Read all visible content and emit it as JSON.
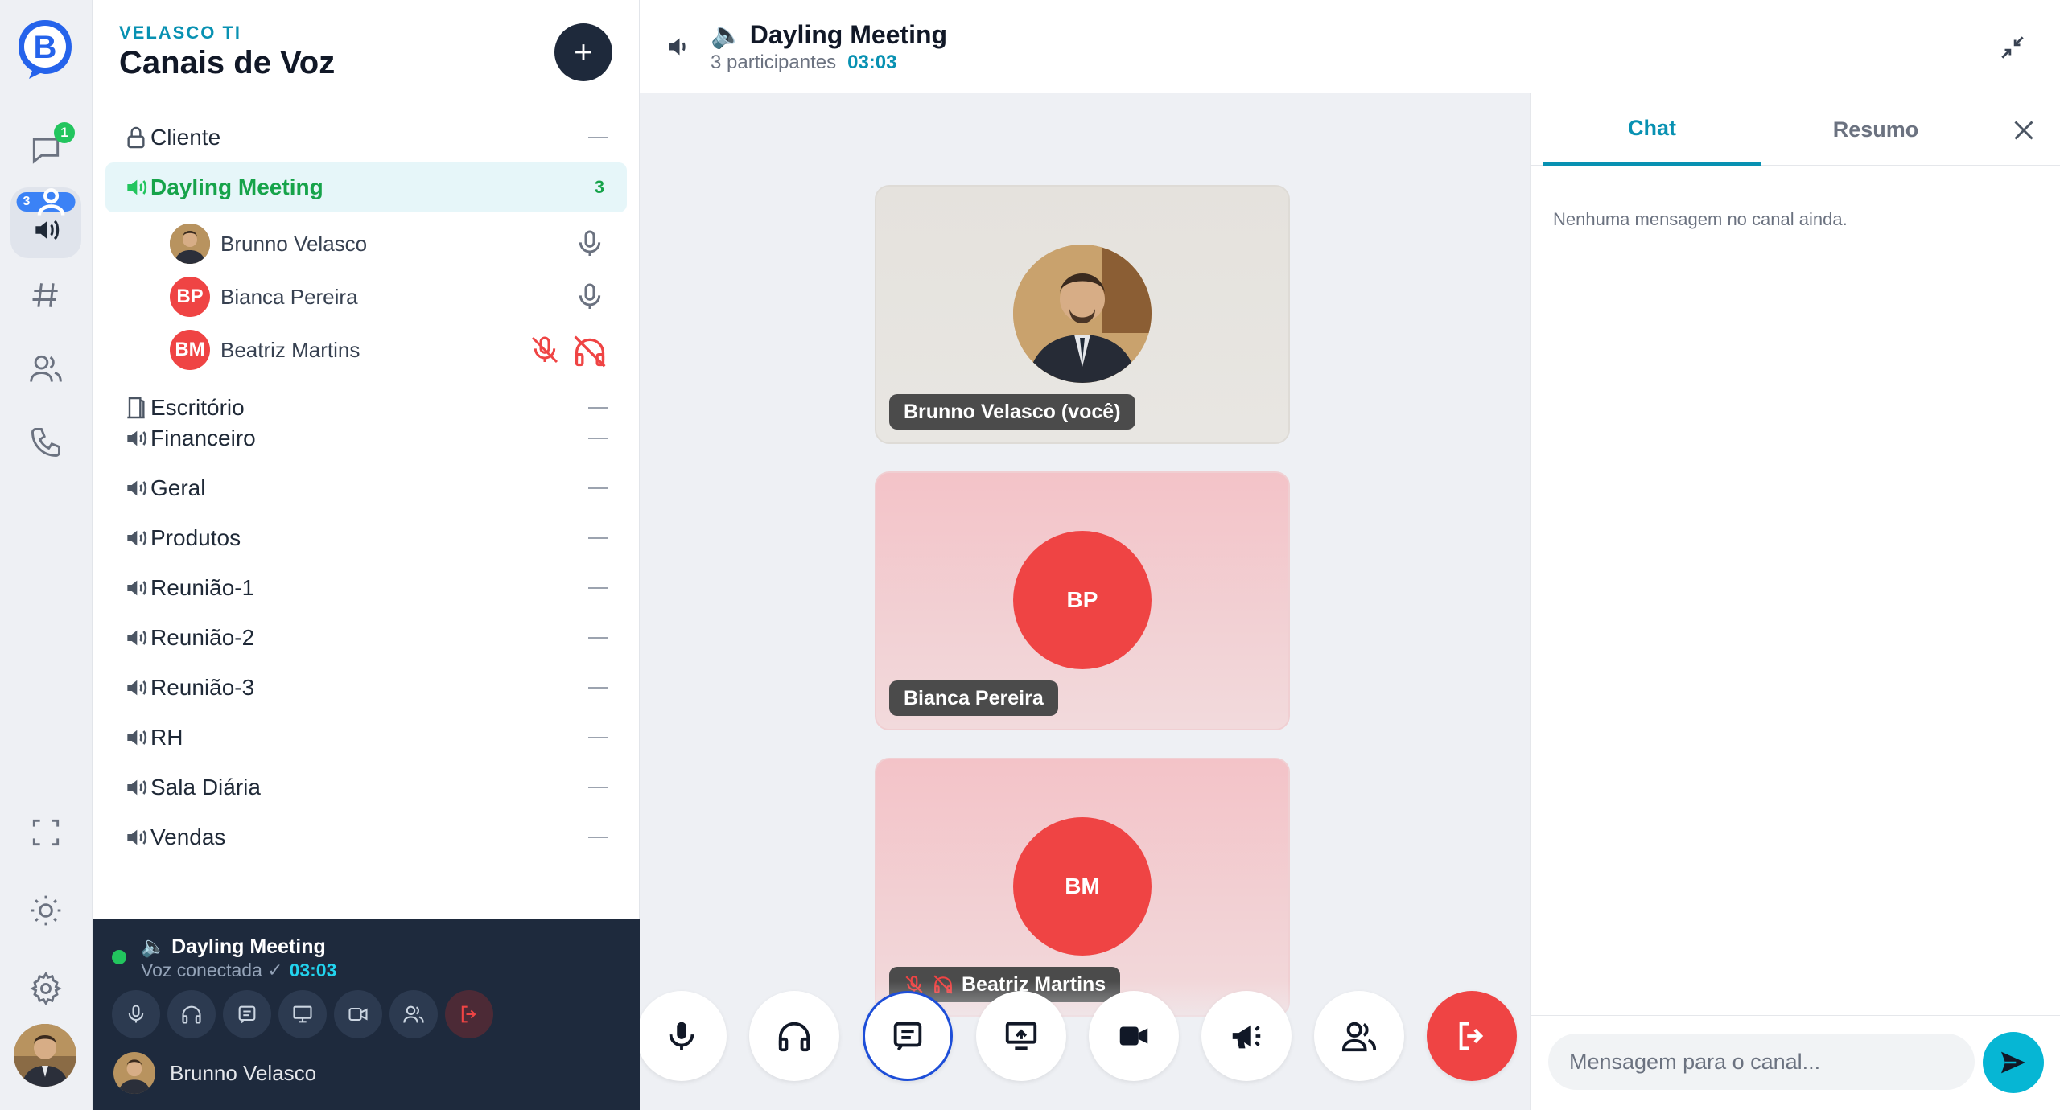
{
  "rail": {
    "logo_letter": "B",
    "chat_badge": "1",
    "voice_badge": "3",
    "items": [
      {
        "icon": "chat-icon"
      },
      {
        "icon": "voice-icon"
      },
      {
        "icon": "hash-icon"
      },
      {
        "icon": "users-icon"
      },
      {
        "icon": "phone-icon"
      }
    ],
    "bottom": [
      {
        "icon": "fullscreen-icon"
      },
      {
        "icon": "sun-icon"
      },
      {
        "icon": "gear-icon"
      }
    ]
  },
  "panel": {
    "org": "VELASCO TI",
    "title": "Canais de Voz",
    "channels_before": [
      {
        "name": "Cliente",
        "icon": "lock-icon"
      }
    ],
    "active_channel": {
      "name": "Dayling Meeting",
      "count": "3"
    },
    "members": [
      {
        "name": "Brunno Velasco",
        "initials": "",
        "photo": true,
        "muted": false
      },
      {
        "name": "Bianca Pereira",
        "initials": "BP",
        "photo": false,
        "muted": false
      },
      {
        "name": "Beatriz Martins",
        "initials": "BM",
        "photo": false,
        "muted": true
      }
    ],
    "channels_after": [
      {
        "name": "Escritório",
        "icon": "door-icon"
      },
      {
        "name": "Financeiro",
        "icon": "speaker-icon"
      },
      {
        "name": "Geral",
        "icon": "speaker-icon"
      },
      {
        "name": "Produtos",
        "icon": "speaker-icon"
      },
      {
        "name": "Reunião-1",
        "icon": "speaker-icon"
      },
      {
        "name": "Reunião-2",
        "icon": "speaker-icon"
      },
      {
        "name": "Reunião-3",
        "icon": "speaker-icon"
      },
      {
        "name": "RH",
        "icon": "speaker-icon"
      },
      {
        "name": "Sala Diária",
        "icon": "speaker-icon"
      },
      {
        "name": "Vendas",
        "icon": "speaker-icon"
      }
    ]
  },
  "voice_box": {
    "title": "🔈 Dayling Meeting",
    "status": "Voz conectada ✓",
    "timer": "03:03",
    "user": "Brunno Velasco"
  },
  "header": {
    "title": "🔈 Dayling Meeting",
    "participants": "3 participantes",
    "timer": "03:03"
  },
  "tiles": [
    {
      "label": "Brunno Velasco (você)",
      "initials": "",
      "photo": true
    },
    {
      "label": "Bianca Pereira",
      "initials": "BP",
      "photo": false
    },
    {
      "label": "Beatriz Martins",
      "initials": "BM",
      "photo": false
    }
  ],
  "chat": {
    "tabs": [
      "Chat",
      "Resumo"
    ],
    "active_tab": "Chat",
    "empty_text": "Nenhuma mensagem no canal ainda.",
    "input_placeholder": "Mensagem para o canal..."
  },
  "colors": {
    "accent": "#0891b2",
    "online": "#22c55e",
    "danger": "#ef4444",
    "navy": "#1e2a3d"
  }
}
